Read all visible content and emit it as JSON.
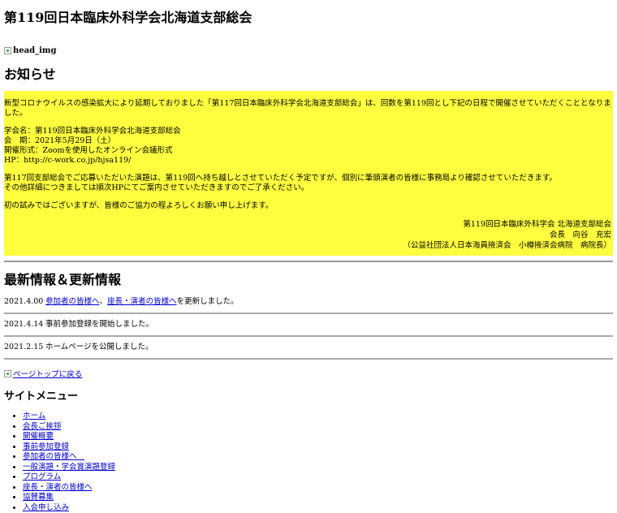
{
  "page_title": "第119回日本臨床外科学会北海道支部総会",
  "head_img_alt": "head_img",
  "notice": {
    "heading": "お知らせ",
    "p1": "新型コロナウイルスの感染拡大により延期しておりました「第117回日本臨床外科学会北海道支部総会」は、回数を第119回とし下記の日程で開催させていただくこととなりました。",
    "info": [
      "学会名：第119回日本臨床外科学会北海道支部総会",
      "会　期：2021年5月29日（土）",
      "開催形式：Zoomを使用したオンライン会議形式",
      "HP：http://c-work.co.jp/hjsa119/"
    ],
    "p3a": "第117回支部総会でご応募いただいた演題は、第119回へ持ち越しとさせていただく予定ですが、個別に筆頭演者の皆様に事務局より確認させていただきます。",
    "p3b": "その他詳細につきましては順次HPにてご案内させていただきますのでご了承ください。",
    "p4": "初の試みではございますが、皆様のご協力の程よろしくお願い申し上げます。",
    "sig": [
      "第119回日本臨床外科学会 北海道支部総会",
      "会長　向谷　充宏",
      "（公益社団法人日本海員掖済会　小樽掖済会病院　病院長）"
    ]
  },
  "news": {
    "heading": "最新情報＆更新情報",
    "items": [
      {
        "date": "2021.4.00",
        "link1": "参加者の皆様へ",
        "sep": "、",
        "link2": "座長・演者の皆様へ",
        "text": "を更新しました。"
      },
      {
        "date": "2021.4.14",
        "text": "事前参加登録を開始しました。"
      },
      {
        "date": "2021.2.15",
        "text": "ホームページを公開しました。"
      }
    ]
  },
  "back_to_top": "ページトップに戻る",
  "menu": {
    "heading": "サイトメニュー",
    "items": [
      "ホーム",
      "会長ご挨拶",
      "開催概要",
      "事前参加登録",
      "参加者の皆様へ　",
      "一般演題・学会賞演題登録",
      "プログラム",
      "座長・演者の皆様へ",
      "協賛募集",
      "入会申し込み"
    ]
  }
}
